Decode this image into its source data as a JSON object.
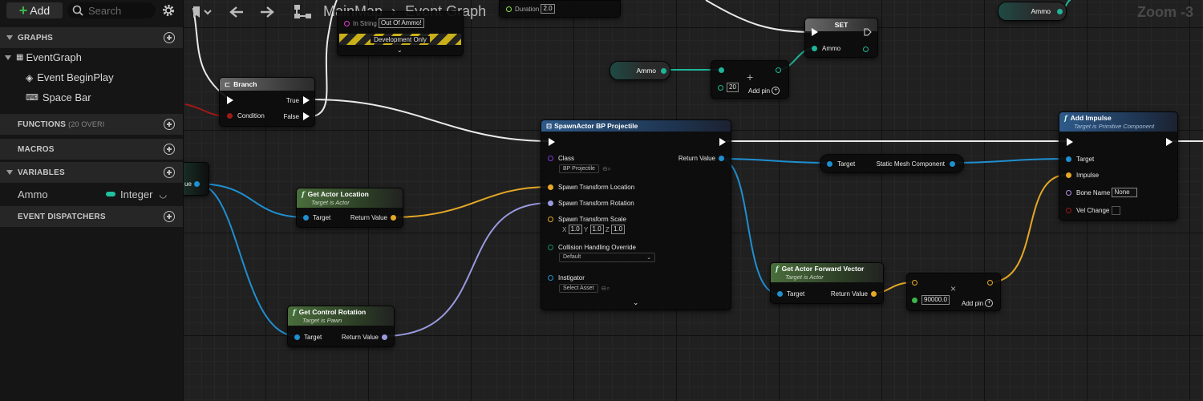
{
  "sidebar": {
    "add_label": "Add",
    "search_placeholder": "Search",
    "graphs_title": "GRAPHS",
    "event_graph": "EventGraph",
    "begin_play": "Event BeginPlay",
    "space_bar": "Space Bar",
    "functions_title": "FUNCTIONS",
    "functions_count": "(20 OVERI",
    "macros_title": "MACROS",
    "variables_title": "VARIABLES",
    "var_name": "Ammo",
    "var_type": "Integer",
    "dispatchers_title": "EVENT DISPATCHERS",
    "colors": {
      "integer": "#20c0a0",
      "exec": "#ffffff"
    }
  },
  "toolbar": {
    "crumb_map": "MainMap",
    "crumb_graph": "Event Graph",
    "zoom": "Zoom -3"
  },
  "nodes": {
    "print": {
      "in_string_label": "In String",
      "in_string_value": "Out Of Ammo!",
      "dev_only": "Development Only",
      "duration_label": "Duration",
      "duration_value": "2.0"
    },
    "set": {
      "title": "SET",
      "ammo": "Ammo"
    },
    "ammo_top": "Ammo",
    "ammo_get": "Ammo",
    "add": {
      "value": "20",
      "add_pin": "Add pin"
    },
    "branch": {
      "title": "Branch",
      "true": "True",
      "condition": "Condition",
      "false": "False"
    },
    "var_left": "ue",
    "spawn": {
      "title": "SpawnActor BP Projectile",
      "class": "Class",
      "class_value": "BP Projectile",
      "return": "Return Value",
      "loc": "Spawn Transform Location",
      "rot": "Spawn Transform Rotation",
      "scale": "Spawn Transform Scale",
      "x": "X",
      "y": "Y",
      "z": "Z",
      "sx": "1.0",
      "sy": "1.0",
      "sz": "1.0",
      "collision": "Collision Handling Override",
      "collision_value": "Default",
      "instigator": "Instigator",
      "instigator_value": "Select Asset"
    },
    "actor_loc": {
      "title": "Get Actor Location",
      "sub": "Target is Actor",
      "target": "Target",
      "ret": "Return Value"
    },
    "ctrl_rot": {
      "title": "Get Control Rotation",
      "sub": "Target is Pawn",
      "target": "Target",
      "ret": "Return Value"
    },
    "smc": {
      "target": "Target",
      "label": "Static Mesh Component"
    },
    "impulse": {
      "title": "Add Impulse",
      "sub": "Target is Primitive Component",
      "target": "Target",
      "impulse": "Impulse",
      "bone": "Bone Name",
      "bone_value": "None",
      "vel": "Vel Change"
    },
    "fwd": {
      "title": "Get Actor Forward Vector",
      "sub": "Target is Actor",
      "target": "Target",
      "ret": "Return Value"
    },
    "mul": {
      "value": "90000.0",
      "add_pin": "Add pin"
    }
  }
}
